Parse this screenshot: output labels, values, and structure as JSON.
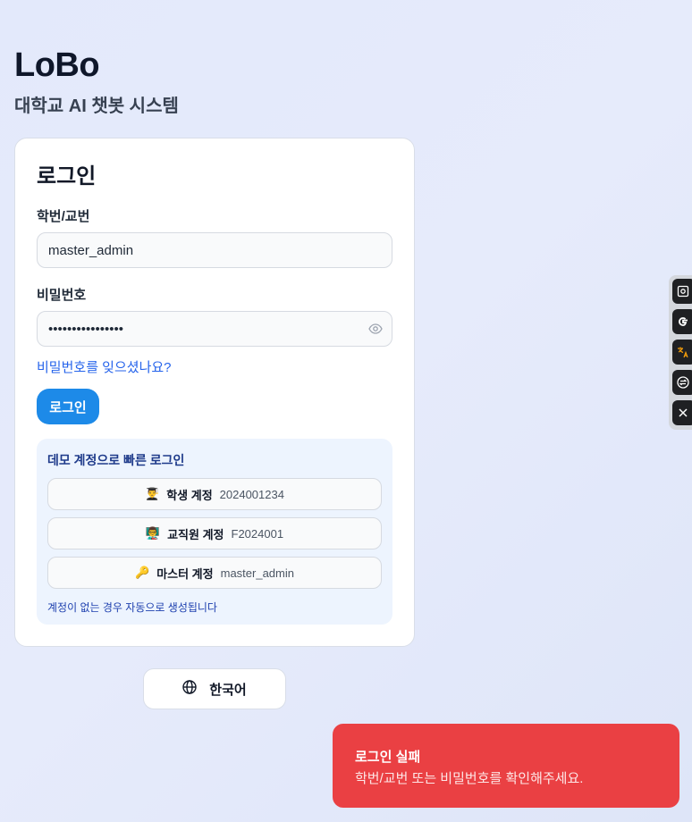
{
  "brand": {
    "title": "LoBo",
    "subtitle": "대학교 AI 챗봇 시스템"
  },
  "login": {
    "title": "로그인",
    "id_label": "학번/교번",
    "id_value": "master_admin",
    "password_label": "비밀번호",
    "password_value": "••••••••••••••••",
    "forgot_link": "비밀번호를 잊으셨나요?",
    "submit_label": "로그인"
  },
  "demo": {
    "title": "데모 계정으로 빠른 로그인",
    "accounts": [
      {
        "emoji": "👨‍🎓",
        "name": "학생 계정",
        "id": "2024001234"
      },
      {
        "emoji": "👨‍🏫",
        "name": "교직원 계정",
        "id": "F2024001"
      },
      {
        "emoji": "🔑",
        "name": "마스터 계정",
        "id": "master_admin"
      }
    ],
    "note": "계정이 없는 경우 자동으로 생성됩니다"
  },
  "language": {
    "label": "한국어",
    "icon": "globe-icon"
  },
  "side_toolbar": {
    "icons": [
      "screenshot-icon",
      "google-icon",
      "translate-icon",
      "exchange-icon",
      "close-icon"
    ]
  },
  "toast": {
    "title": "로그인 실패",
    "message": "학번/교번 또는 비밀번호를 확인해주세요.",
    "color": "#ea4043"
  },
  "colors": {
    "primary": "#1d8ae8",
    "link": "#2563eb",
    "demo_bg": "#edf4fe"
  }
}
